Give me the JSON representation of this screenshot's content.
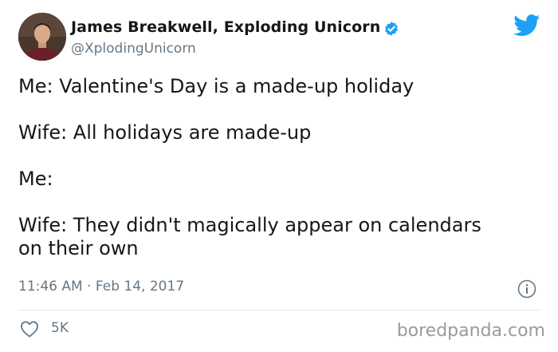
{
  "author": {
    "display_name": "James Breakwell, Exploding Unicorn",
    "handle": "@XplodingUnicorn",
    "verified": true
  },
  "tweet": {
    "lines": [
      "Me: Valentine's Day is a made-up holiday",
      "Wife: All holidays are made-up",
      "Me:",
      "Wife: They didn't magically appear on calendars",
      "on their own"
    ],
    "timestamp": "11:46 AM · Feb 14, 2017",
    "likes": "5K"
  },
  "watermark": "boredpanda.com",
  "colors": {
    "text": "#14171a",
    "secondary": "#657786",
    "twitter_blue": "#1da1f2",
    "divider": "#e1e8ed"
  },
  "icons": [
    "avatar-photo",
    "verified-badge-icon",
    "twitter-bird-icon",
    "info-icon",
    "heart-icon"
  ]
}
